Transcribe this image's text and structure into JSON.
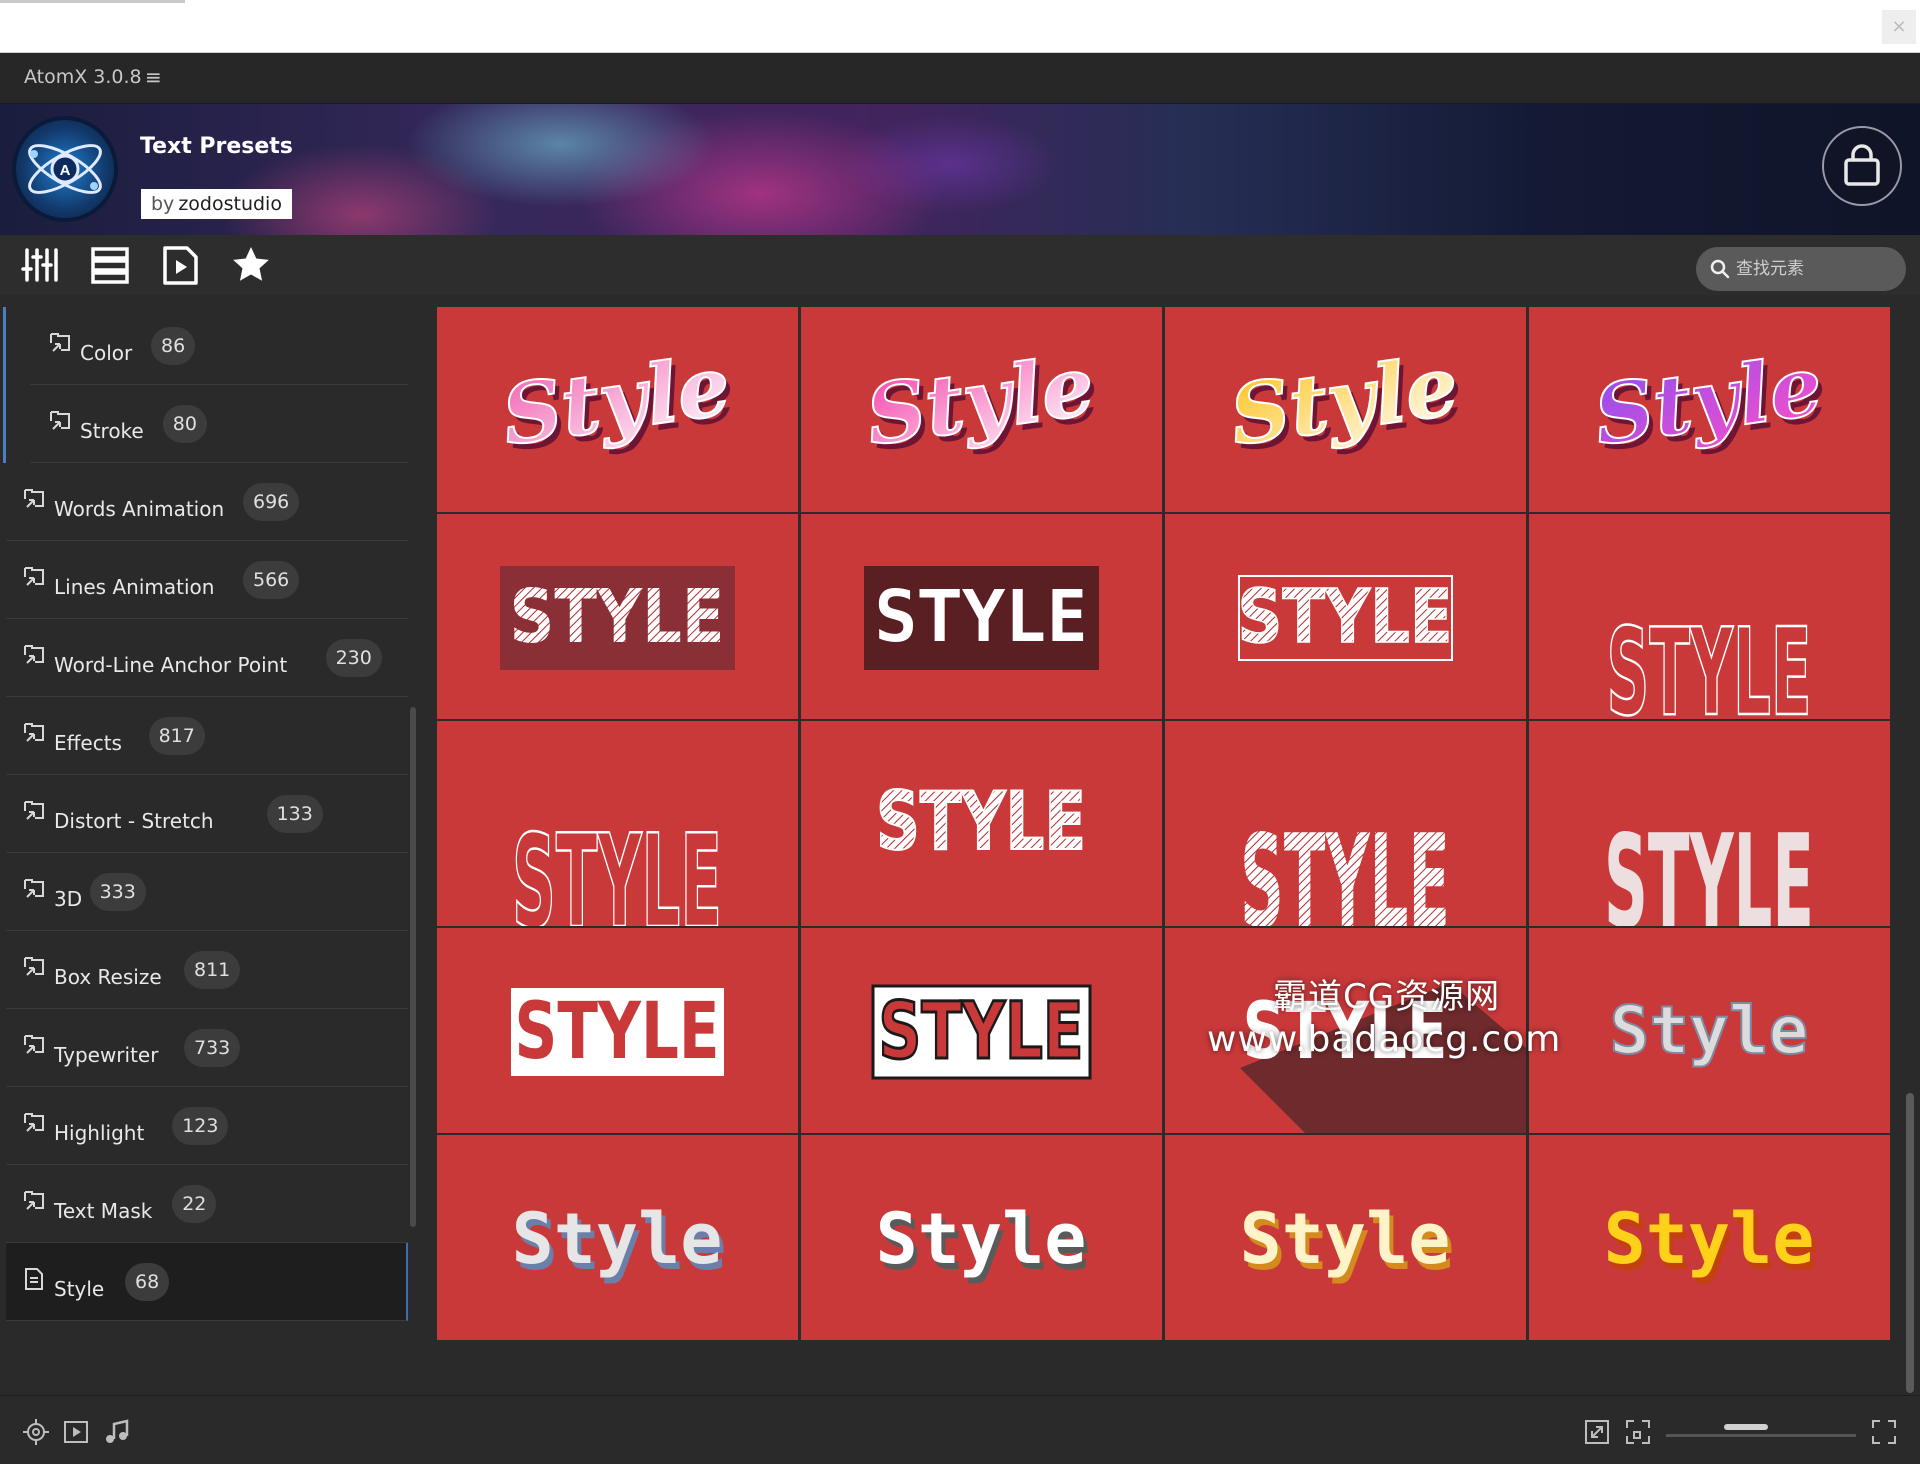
{
  "app": {
    "title": "AtomX 3.0.8",
    "menu_icon": "hamburger-icon",
    "close_glyph": "×"
  },
  "banner": {
    "title": "Text Presets",
    "by": "by",
    "author": "zodostudio"
  },
  "toolbar": {
    "icons": [
      "sliders-icon",
      "list-icon",
      "play-file-icon",
      "star-icon"
    ],
    "search_placeholder": "查找元素"
  },
  "sidebar": {
    "items": [
      {
        "label": "Color",
        "count": "86",
        "sub": true
      },
      {
        "label": "Stroke",
        "count": "80",
        "sub": true
      },
      {
        "label": "Words Animation",
        "count": "696"
      },
      {
        "label": "Lines Animation",
        "count": "566"
      },
      {
        "label": "Word-Line Anchor Point",
        "count": "230"
      },
      {
        "label": "Effects",
        "count": "817"
      },
      {
        "label": "Distort - Stretch",
        "count": "133"
      },
      {
        "label": "3D",
        "count": "333"
      },
      {
        "label": "Box Resize",
        "count": "811"
      },
      {
        "label": "Typewriter",
        "count": "733"
      },
      {
        "label": "Highlight",
        "count": "123"
      },
      {
        "label": "Text Mask",
        "count": "22"
      },
      {
        "label": "Style",
        "count": "68",
        "active": true
      }
    ]
  },
  "presets": {
    "row1": [
      "Style",
      "Style",
      "Style",
      "Style"
    ],
    "row2": [
      "STYLE",
      "STYLE",
      "STYLE",
      "STYLE"
    ],
    "row3": [
      "STYLE",
      "STYLE",
      "STYLE",
      "STYLE"
    ],
    "row4": [
      "STYLE",
      "STYLE",
      "STYLE",
      "Style"
    ],
    "row5": [
      "Style",
      "Style",
      "Style",
      "Style"
    ]
  },
  "watermark": {
    "line1": "霸道CG资源网",
    "line2": "www.badaocg.com"
  },
  "colors": {
    "tile_bg": "#c9393a",
    "panel_bg": "#2a2a2a",
    "accent": "#4c7fc2"
  }
}
